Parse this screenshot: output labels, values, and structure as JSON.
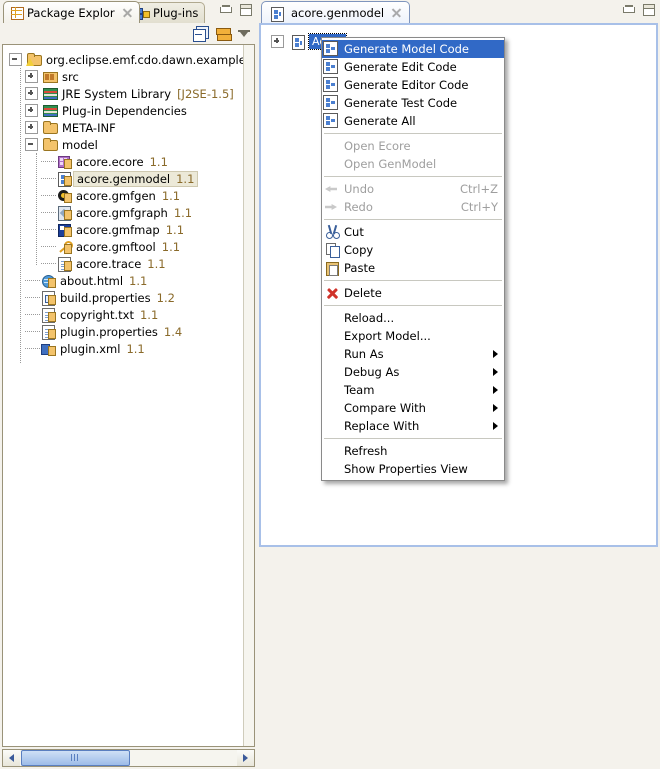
{
  "window": {
    "left_panel": {
      "tabs": [
        {
          "label": "Package Explor",
          "icon": "package-explorer-icon",
          "active": true,
          "closable": true
        },
        {
          "label": "Plug-ins",
          "icon": "plugins-icon",
          "active": false,
          "closable": false
        }
      ],
      "toolbar": [
        {
          "name": "collapse-all-icon",
          "title": "Collapse All"
        },
        {
          "name": "link-with-editor-icon",
          "title": "Link with Editor"
        },
        {
          "name": "view-menu-icon",
          "title": "View Menu"
        }
      ],
      "window_buttons": [
        {
          "name": "minimize-icon"
        },
        {
          "name": "maximize-icon"
        }
      ],
      "tree": [
        {
          "indent": 0,
          "expander": "minus",
          "icon": "java-project-icon",
          "label": "org.eclipse.emf.cdo.dawn.examples.acore",
          "version": "",
          "selected": false
        },
        {
          "indent": 1,
          "expander": "plus",
          "icon": "source-folder-icon",
          "label": "src",
          "version": "",
          "selected": false
        },
        {
          "indent": 1,
          "expander": "plus",
          "icon": "library-icon",
          "label": "JRE System Library",
          "version": "",
          "suffix": "[J2SE-1.5]",
          "selected": false
        },
        {
          "indent": 1,
          "expander": "plus",
          "icon": "library-icon",
          "label": "Plug-in Dependencies",
          "version": "",
          "selected": false
        },
        {
          "indent": 1,
          "expander": "plus",
          "icon": "folder-icon",
          "label": "META-INF",
          "version": "",
          "selected": false
        },
        {
          "indent": 1,
          "expander": "minus",
          "icon": "folder-icon",
          "label": "model",
          "version": "",
          "selected": false
        },
        {
          "indent": 2,
          "expander": "none",
          "icon": "ecore-file-icon",
          "label": "acore.ecore",
          "version": "1.1",
          "selected": false
        },
        {
          "indent": 2,
          "expander": "none",
          "icon": "genmodel-file-icon",
          "label": "acore.genmodel",
          "version": "1.1",
          "selected": true
        },
        {
          "indent": 2,
          "expander": "none",
          "icon": "gmfgen-file-icon",
          "label": "acore.gmfgen",
          "version": "1.1",
          "selected": false
        },
        {
          "indent": 2,
          "expander": "none",
          "icon": "gmfgraph-file-icon",
          "label": "acore.gmfgraph",
          "version": "1.1",
          "selected": false
        },
        {
          "indent": 2,
          "expander": "none",
          "icon": "gmfmap-file-icon",
          "label": "acore.gmfmap",
          "version": "1.1",
          "selected": false
        },
        {
          "indent": 2,
          "expander": "none",
          "icon": "gmftool-file-icon",
          "label": "acore.gmftool",
          "version": "1.1",
          "selected": false
        },
        {
          "indent": 2,
          "expander": "none",
          "icon": "trace-file-icon",
          "label": "acore.trace",
          "version": "1.1",
          "selected": false
        },
        {
          "indent": 1,
          "expander": "none",
          "icon": "html-file-icon",
          "label": "about.html",
          "version": "1.1",
          "selected": false
        },
        {
          "indent": 1,
          "expander": "none",
          "icon": "properties-file-icon",
          "label": "build.properties",
          "version": "1.2",
          "selected": false
        },
        {
          "indent": 1,
          "expander": "none",
          "icon": "text-file-icon",
          "label": "copyright.txt",
          "version": "1.1",
          "selected": false
        },
        {
          "indent": 1,
          "expander": "none",
          "icon": "text-file-icon",
          "label": "plugin.properties",
          "version": "1.4",
          "selected": false
        },
        {
          "indent": 1,
          "expander": "none",
          "icon": "xml-file-icon",
          "label": "plugin.xml",
          "version": "1.1",
          "selected": false
        }
      ],
      "hscrollbar": {
        "left_arrow": "◀",
        "right_arrow": "▶"
      }
    },
    "right_panel": {
      "tab": {
        "label": "acore.genmodel",
        "icon": "genmodel-file-icon",
        "closable": true
      },
      "window_buttons": [
        {
          "name": "minimize-icon"
        },
        {
          "name": "maximize-icon"
        }
      ],
      "editor_tree": {
        "expander": "plus",
        "icon": "genmodel-root-icon",
        "label": "Acore",
        "selected": true
      }
    },
    "context_menu": {
      "items": [
        {
          "label": "Generate Model Code",
          "icon": "generate-icon",
          "state": "highlighted",
          "accel": "",
          "submenu": false
        },
        {
          "label": "Generate Edit Code",
          "icon": "generate-icon",
          "state": "normal",
          "accel": "",
          "submenu": false
        },
        {
          "label": "Generate Editor Code",
          "icon": "generate-icon",
          "state": "normal",
          "accel": "",
          "submenu": false
        },
        {
          "label": "Generate Test Code",
          "icon": "generate-icon",
          "state": "normal",
          "accel": "",
          "submenu": false
        },
        {
          "label": "Generate All",
          "icon": "generate-icon",
          "state": "normal",
          "accel": "",
          "submenu": false
        },
        {
          "separator": true
        },
        {
          "label": "Open Ecore",
          "icon": "",
          "state": "disabled",
          "accel": "",
          "submenu": false
        },
        {
          "label": "Open GenModel",
          "icon": "",
          "state": "disabled",
          "accel": "",
          "submenu": false
        },
        {
          "separator": true
        },
        {
          "label": "Undo",
          "icon": "undo-icon",
          "state": "disabled",
          "accel": "Ctrl+Z",
          "submenu": false
        },
        {
          "label": "Redo",
          "icon": "redo-icon",
          "state": "disabled",
          "accel": "Ctrl+Y",
          "submenu": false
        },
        {
          "separator": true
        },
        {
          "label": "Cut",
          "icon": "cut-icon",
          "state": "normal",
          "accel": "",
          "submenu": false
        },
        {
          "label": "Copy",
          "icon": "copy-icon",
          "state": "normal",
          "accel": "",
          "submenu": false
        },
        {
          "label": "Paste",
          "icon": "paste-icon",
          "state": "normal",
          "accel": "",
          "submenu": false
        },
        {
          "separator": true
        },
        {
          "label": "Delete",
          "icon": "delete-icon",
          "state": "normal",
          "accel": "",
          "submenu": false
        },
        {
          "separator": true
        },
        {
          "label": "Reload...",
          "icon": "",
          "state": "normal",
          "accel": "",
          "submenu": false
        },
        {
          "label": "Export Model...",
          "icon": "",
          "state": "normal",
          "accel": "",
          "submenu": false
        },
        {
          "label": "Run As",
          "icon": "",
          "state": "normal",
          "accel": "",
          "submenu": true
        },
        {
          "label": "Debug As",
          "icon": "",
          "state": "normal",
          "accel": "",
          "submenu": true
        },
        {
          "label": "Team",
          "icon": "",
          "state": "normal",
          "accel": "",
          "submenu": true
        },
        {
          "label": "Compare With",
          "icon": "",
          "state": "normal",
          "accel": "",
          "submenu": true
        },
        {
          "label": "Replace With",
          "icon": "",
          "state": "normal",
          "accel": "",
          "submenu": true
        },
        {
          "separator": true
        },
        {
          "label": "Refresh",
          "icon": "",
          "state": "normal",
          "accel": "",
          "submenu": false
        },
        {
          "label": "Show Properties View",
          "icon": "",
          "state": "normal",
          "accel": "",
          "submenu": false
        }
      ]
    },
    "colors": {
      "menu_highlight": "#3169c6",
      "tree_selection": "#ece9d8",
      "version_text": "#8a6a2a",
      "editor_border": "#a8c0e8",
      "chrome": "#f4f2ec"
    }
  }
}
